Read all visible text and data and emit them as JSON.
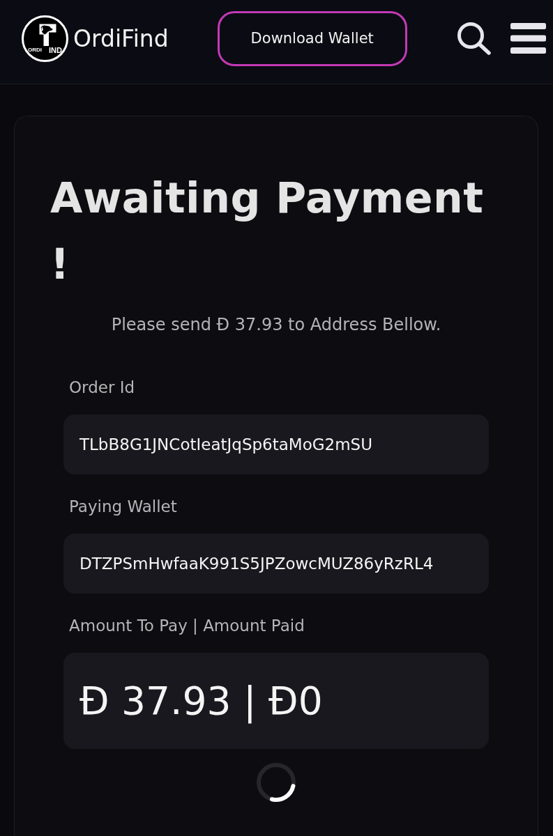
{
  "header": {
    "logo": {
      "small_text": "ORDI",
      "text": "IND"
    },
    "brand": "OrdiFind",
    "download_button": "Download Wallet"
  },
  "card": {
    "title": "Awaiting Payment !",
    "instruction": "Please send Đ 37.93 to Address Bellow.",
    "fields": [
      {
        "kind": "text",
        "label": "Order Id",
        "value": "TLbB8G1JNCotIeatJqSp6taMoG2mSU"
      },
      {
        "kind": "text",
        "label": "Paying Wallet",
        "value": "DTZPSmHwfaaK991S5JPZowcMUZ86yRzRL4"
      },
      {
        "kind": "amount",
        "label": "Amount To Pay | Amount Paid",
        "value": "Đ 37.93 | Đ0"
      }
    ],
    "loading": true
  }
}
